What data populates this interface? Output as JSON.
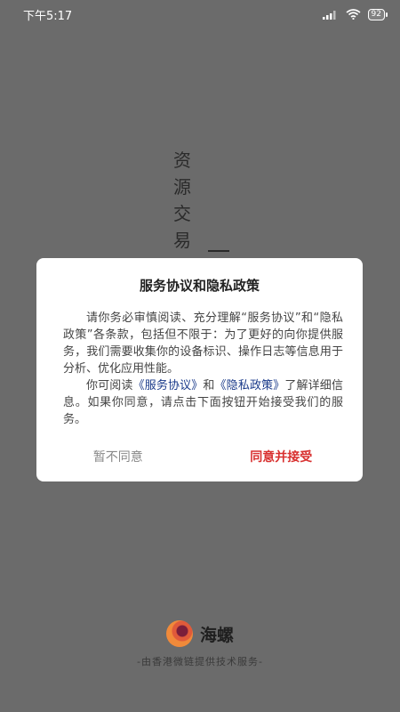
{
  "status_bar": {
    "time": "下午5:17",
    "battery": "92",
    "icons": [
      "signal-icon",
      "wifi-icon",
      "battery-icon"
    ]
  },
  "background": {
    "vertical_text": "资源交易"
  },
  "dialog": {
    "title": "服务协议和隐私政策",
    "paragraph1": "请你务必审慎阅读、充分理解“服务协议”和“隐私政策”各条款，包括但不限于：为了更好的向你提供服务，我们需要收集你的设备标识、操作日志等信息用于分析、优化应用性能。",
    "paragraph2_prefix": "你可阅读",
    "service_link": "《服务协议》",
    "and": "和",
    "privacy_link": "《隐私政策》",
    "paragraph2_suffix": "了解详细信息。如果你同意，请点击下面按钮开始接受我们的服务。",
    "decline_label": "暂不同意",
    "accept_label": "同意并接受",
    "colors": {
      "accept": "#d8302f",
      "link": "#1a3a8a"
    }
  },
  "brand": {
    "name": "海螺",
    "subtitle": "-由香港微链提供技术服务-"
  }
}
